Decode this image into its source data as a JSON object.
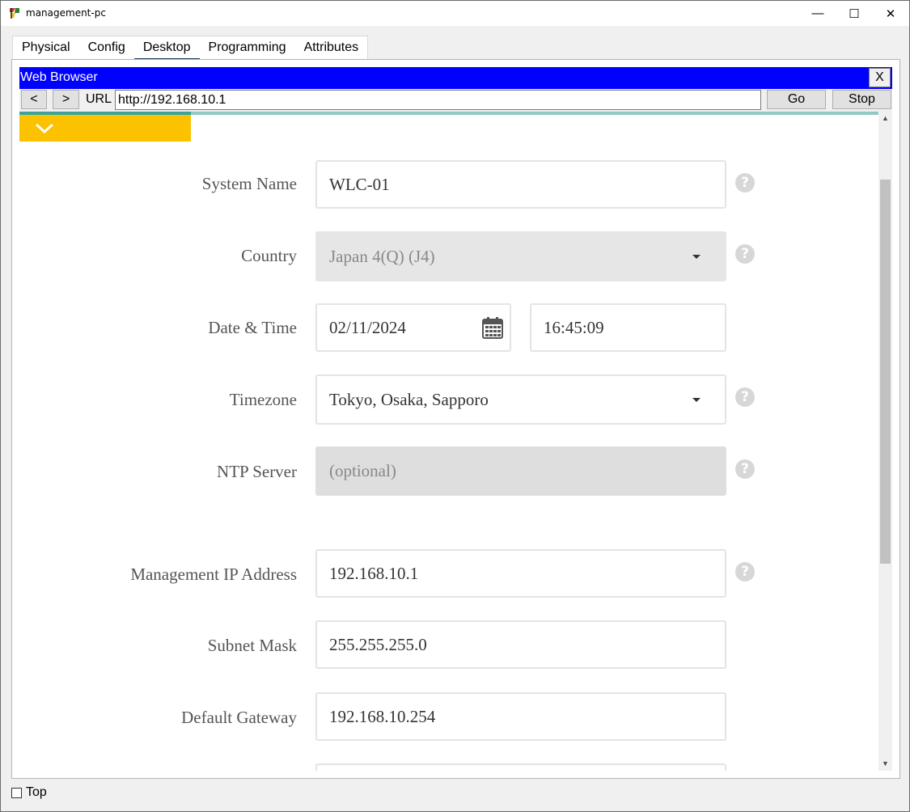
{
  "window": {
    "title": "management-pc",
    "min_glyph": "—",
    "max_glyph": "☐",
    "close_glyph": "✕"
  },
  "tabs": [
    {
      "label": "Physical"
    },
    {
      "label": "Config"
    },
    {
      "label": "Desktop",
      "active": true
    },
    {
      "label": "Programming"
    },
    {
      "label": "Attributes"
    }
  ],
  "browser": {
    "title": "Web Browser",
    "close_label": "X",
    "back_label": "<",
    "forward_label": ">",
    "url_label": "URL",
    "url": "http://192.168.10.1",
    "go_label": "Go",
    "stop_label": "Stop"
  },
  "colors": {
    "browser_header": "#0000ff",
    "accent_yellow": "#fcc200",
    "accent_teal": "#3aa39b"
  },
  "form": {
    "system_name": {
      "label": "System Name",
      "value": "WLC-01"
    },
    "country": {
      "label": "Country",
      "value": "Japan 4(Q) (J4)",
      "disabled": true
    },
    "datetime": {
      "label": "Date & Time",
      "date": "02/11/2024",
      "time": "16:45:09"
    },
    "timezone": {
      "label": "Timezone",
      "value": "Tokyo, Osaka, Sapporo"
    },
    "ntp_server": {
      "label": "NTP Server",
      "placeholder": "(optional)",
      "disabled": true
    },
    "mgmt_ip": {
      "label": "Management IP Address",
      "value": "192.168.10.1"
    },
    "subnet_mask": {
      "label": "Subnet Mask",
      "value": "255.255.255.0"
    },
    "default_gateway": {
      "label": "Default Gateway",
      "value": "192.168.10.254"
    },
    "help_glyph": "?"
  },
  "footer": {
    "top_label": "Top",
    "top_checked": false
  }
}
